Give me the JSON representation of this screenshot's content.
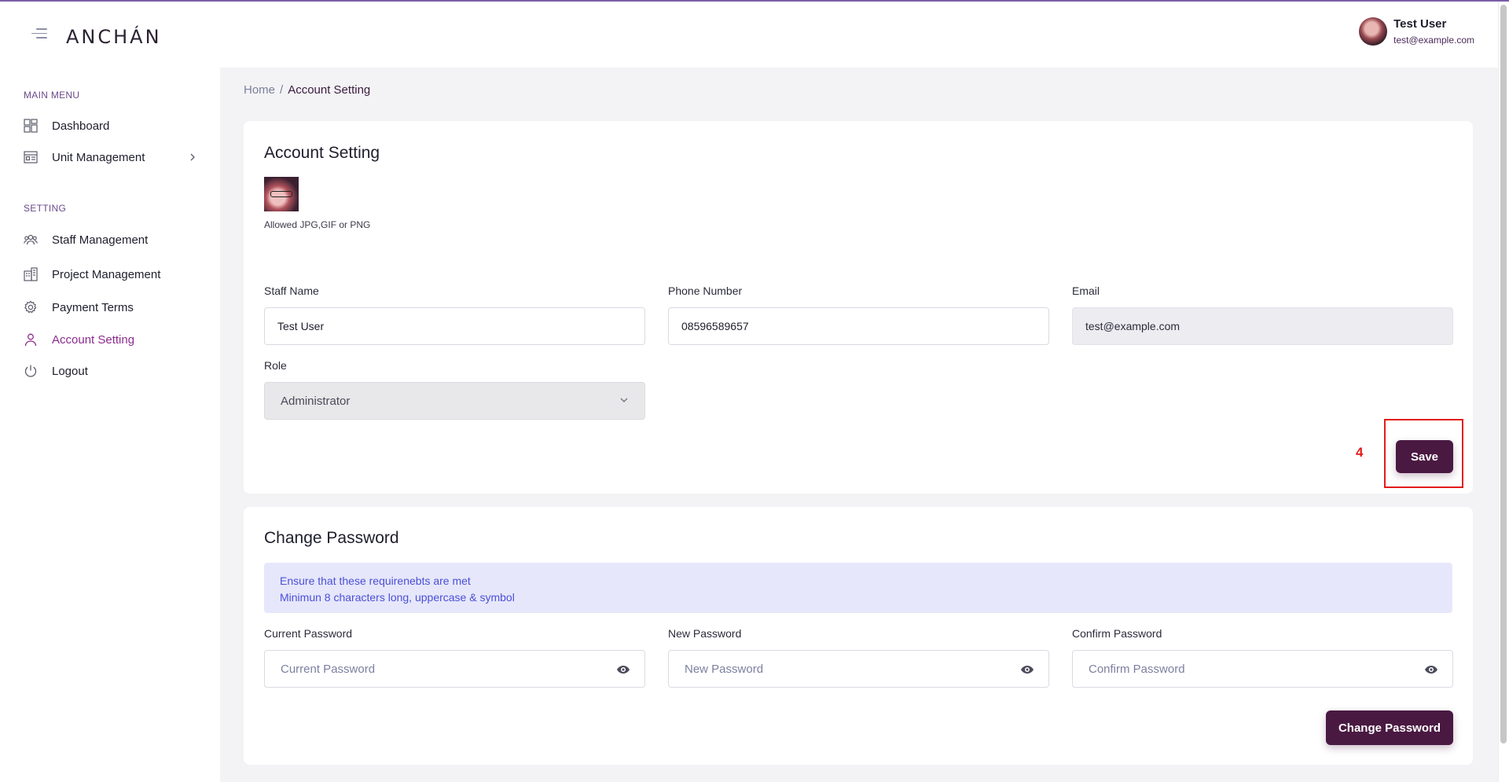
{
  "header": {
    "logo": "ANCHÁN",
    "user_name": "Test User",
    "user_email": "test@example.com"
  },
  "sidebar": {
    "sections": [
      {
        "label": "MAIN MENU"
      },
      {
        "label": "SETTING"
      }
    ],
    "items": [
      {
        "label": "Dashboard",
        "icon": "dashboard-icon"
      },
      {
        "label": "Unit Management",
        "icon": "unit-management-icon"
      },
      {
        "label": "Staff Management",
        "icon": "staff-icon"
      },
      {
        "label": "Project Management",
        "icon": "building-icon"
      },
      {
        "label": "Payment Terms",
        "icon": "gear-icon"
      },
      {
        "label": "Account Setting",
        "icon": "user-icon",
        "active": true
      },
      {
        "label": "Logout",
        "icon": "power-icon"
      }
    ]
  },
  "breadcrumb": {
    "home": "Home",
    "separator": "/",
    "current": "Account Setting"
  },
  "account": {
    "title": "Account Setting",
    "photo_hint": "Allowed JPG,GIF or PNG",
    "staff_name_label": "Staff Name",
    "staff_name_value": "Test User",
    "phone_label": "Phone Number",
    "phone_value": "08596589657",
    "email_label": "Email",
    "email_value": "test@example.com",
    "role_label": "Role",
    "role_value": "Administrator",
    "save_label": "Save",
    "step_number": "4"
  },
  "password": {
    "title": "Change Password",
    "info_line1": "Ensure that these requirenebts are met",
    "info_line2": "Minimun 8 characters long, uppercase & symbol",
    "current_label": "Current Password",
    "current_placeholder": "Current Password",
    "new_label": "New Password",
    "new_placeholder": "New Password",
    "confirm_label": "Confirm Password",
    "confirm_placeholder": "Confirm Password",
    "submit_label": "Change Password"
  },
  "colors": {
    "primary": "#4a1942",
    "active_menu": "#8c2b8f",
    "info_bg": "#e6e7fb",
    "info_text": "#4b4fd6",
    "highlight": "#e41b1b"
  }
}
